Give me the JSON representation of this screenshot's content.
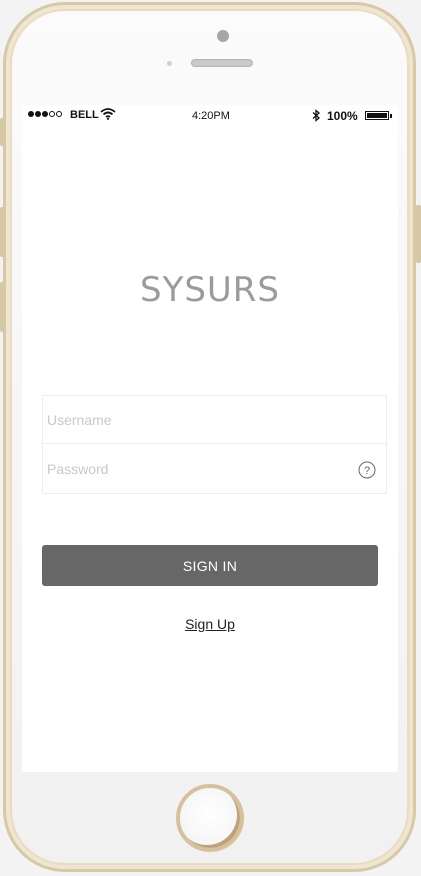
{
  "status_bar": {
    "signal_dots": [
      "full",
      "full",
      "full",
      "empty",
      "empty"
    ],
    "carrier": "BELL",
    "time": "4:20PM",
    "battery_percent": "100%"
  },
  "app": {
    "title": "SYSURS"
  },
  "login_form": {
    "username_placeholder": "Username",
    "password_placeholder": "Password",
    "help_icon": "question-circle-icon"
  },
  "actions": {
    "sign_in_label": "SIGN IN",
    "sign_up_label": "Sign Up"
  },
  "colors": {
    "button": "#676767",
    "title": "#9b9b9b",
    "phone_frame": "#d8c9a6"
  }
}
